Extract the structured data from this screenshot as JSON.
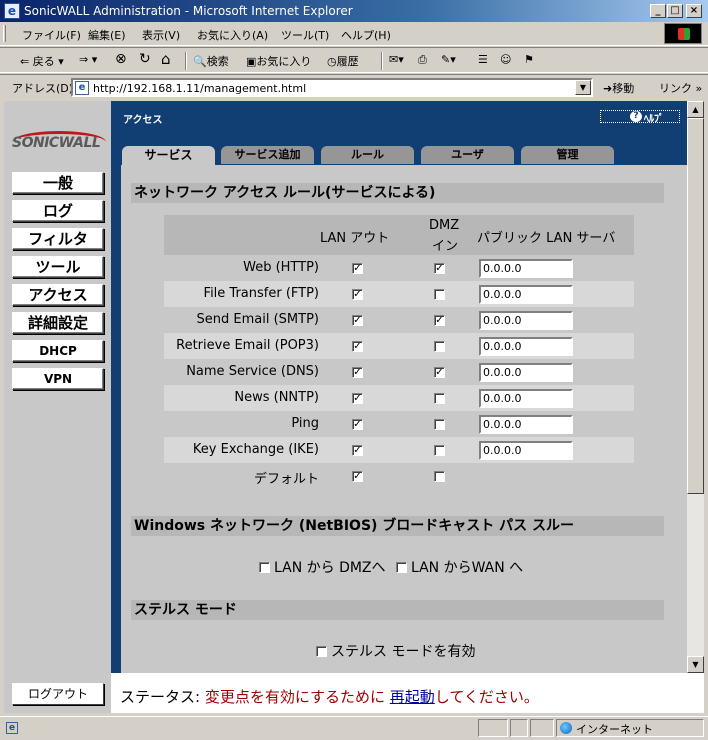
{
  "window": {
    "title": "SonicWALL Administration - Microsoft Internet Explorer",
    "minimize": "_",
    "maximize": "□",
    "close": "×"
  },
  "menu": [
    "ファイル(F)",
    "編集(E)",
    "表示(V)",
    "お気に入り(A)",
    "ツール(T)",
    "ヘルプ(H)"
  ],
  "toolbar": {
    "back": "⇐ 戻る ▾",
    "forward": "⇒ ▾",
    "stop": "⊗",
    "refresh": "↻",
    "home": "⌂",
    "search": "検索",
    "favorites": "お気に入り",
    "history": "履歴"
  },
  "address": {
    "label": "アドレス(D)",
    "url": "http://192.168.1.11/management.html",
    "go": "移動",
    "links": "リンク »"
  },
  "logo": "SONICWALL",
  "nav": [
    {
      "label": "一般"
    },
    {
      "label": "ログ"
    },
    {
      "label": "フィルタ"
    },
    {
      "label": "ツール"
    },
    {
      "label": "アクセス"
    },
    {
      "label": "詳細設定"
    },
    {
      "label": "DHCP"
    },
    {
      "label": "VPN"
    }
  ],
  "section_title": "アクセス",
  "help": "ﾍﾙﾌﾟ",
  "tabs": [
    {
      "label": "サービス",
      "active": true
    },
    {
      "label": "サービス追加",
      "active": false
    },
    {
      "label": "ルール",
      "active": false
    },
    {
      "label": "ユーザ",
      "active": false
    },
    {
      "label": "管理",
      "active": false
    }
  ],
  "rules_section": {
    "heading": "ネットワーク アクセス ルール(サービスによる)",
    "col_lan": "LAN アウト",
    "col_dmz_1": "DMZ",
    "col_dmz_2": "イン",
    "col_public": "パブリック LAN サーバ",
    "rows": [
      {
        "name": "Web (HTTP)",
        "lan": true,
        "dmz": true,
        "ip": "0.0.0.0"
      },
      {
        "name": "File Transfer (FTP)",
        "lan": true,
        "dmz": false,
        "ip": "0.0.0.0"
      },
      {
        "name": "Send Email (SMTP)",
        "lan": true,
        "dmz": true,
        "ip": "0.0.0.0"
      },
      {
        "name": "Retrieve Email (POP3)",
        "lan": true,
        "dmz": false,
        "ip": "0.0.0.0"
      },
      {
        "name": "Name Service (DNS)",
        "lan": true,
        "dmz": true,
        "ip": "0.0.0.0"
      },
      {
        "name": "News (NNTP)",
        "lan": true,
        "dmz": false,
        "ip": "0.0.0.0"
      },
      {
        "name": "Ping",
        "lan": true,
        "dmz": false,
        "ip": "0.0.0.0"
      },
      {
        "name": "Key Exchange (IKE)",
        "lan": true,
        "dmz": false,
        "ip": "0.0.0.0"
      },
      {
        "name": "デフォルト",
        "lan": true,
        "dmz": false,
        "ip": null
      }
    ]
  },
  "netbios_section": {
    "heading": "Windows ネットワーク (NetBIOS) ブロードキャスト パス スルー",
    "opt_dmz": "LAN から DMZへ",
    "opt_dmz_checked": false,
    "opt_wan": "LAN からWAN へ",
    "opt_wan_checked": false
  },
  "stealth_section": {
    "heading": "ステルス モード",
    "opt": "ステルス モードを有効",
    "opt_checked": false
  },
  "logout": "ログアウト",
  "status": {
    "label": "ステータス: ",
    "msg_pre": "変更点を有効にするために ",
    "link": "再起動",
    "msg_post": "してください。"
  },
  "ie_status": {
    "zone": "インターネット"
  }
}
